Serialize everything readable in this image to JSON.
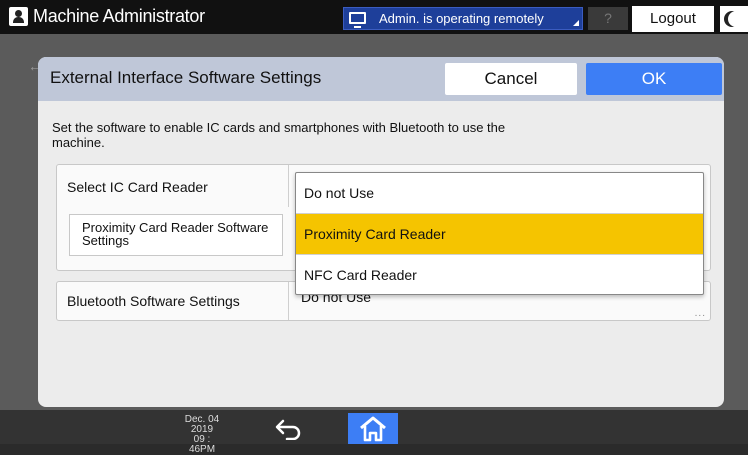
{
  "topbar": {
    "user_title": "Machine Administrator",
    "remote_status": "Admin. is operating remotely",
    "help_label": "?",
    "logout_label": "Logout"
  },
  "dialog": {
    "title": "External Interface Software Settings",
    "cancel_label": "Cancel",
    "ok_label": "OK",
    "description": "Set the software to enable IC cards and smartphones with Bluetooth to use the machine.",
    "rows": {
      "ic_reader_label": "Select IC Card Reader",
      "proximity_label": "Proximity Card Reader Software Settings",
      "bluetooth_label": "Bluetooth Software Settings",
      "bluetooth_value": "Do not Use"
    },
    "dropdown": {
      "options": [
        "Do not Use",
        "Proximity Card Reader",
        "NFC Card Reader"
      ],
      "highlighted": "Proximity Card Reader"
    }
  },
  "bottombar": {
    "date": "Dec. 04 2019",
    "time": "09 : 46PM"
  },
  "colors": {
    "accent_blue": "#3d7ef5",
    "highlight_yellow": "#f5c400",
    "dialog_header": "#bfc7d8"
  }
}
